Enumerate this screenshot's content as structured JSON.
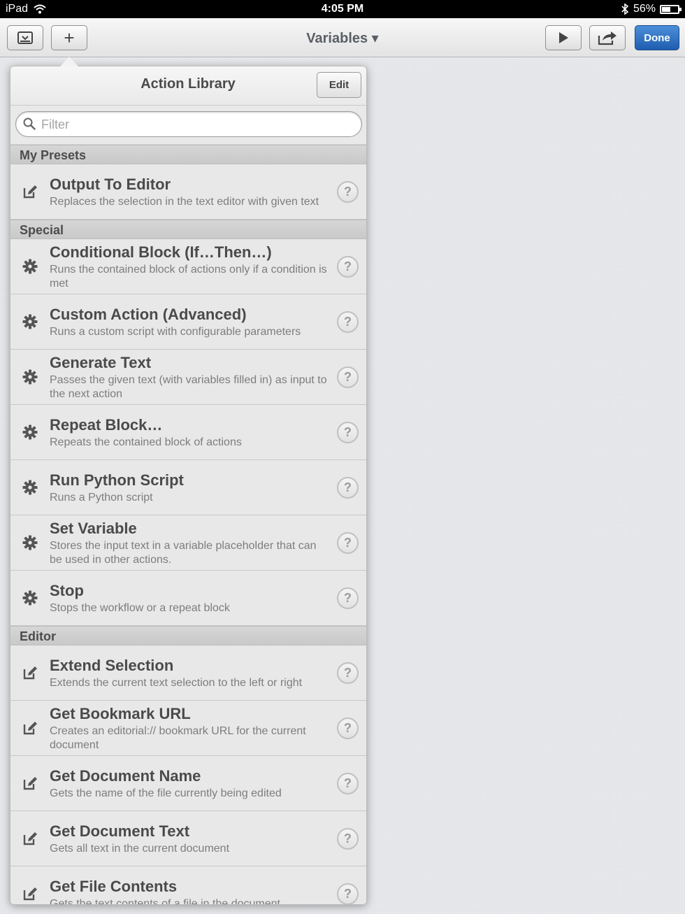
{
  "status_bar": {
    "device": "iPad",
    "time": "4:05 PM",
    "battery": "56%",
    "battery_level": 0.56
  },
  "toolbar": {
    "title": "Variables ▾",
    "done_label": "Done",
    "add_label": "+"
  },
  "popover": {
    "title": "Action Library",
    "edit_label": "Edit",
    "filter_placeholder": "Filter",
    "help_label": "?"
  },
  "sections": [
    {
      "name": "My Presets",
      "items": [
        {
          "title": "Output To Editor",
          "desc": "Replaces the selection in the text editor with given text",
          "icon": "pencil-icon"
        }
      ]
    },
    {
      "name": "Special",
      "items": [
        {
          "title": "Conditional Block (If…Then…)",
          "desc": "Runs the contained block of actions only if a condition is met",
          "icon": "gear-icon"
        },
        {
          "title": "Custom Action (Advanced)",
          "desc": "Runs a custom script with configurable parameters",
          "icon": "gear-icon"
        },
        {
          "title": "Generate Text",
          "desc": "Passes the given text (with variables filled in) as input to the next action",
          "icon": "gear-icon"
        },
        {
          "title": "Repeat Block…",
          "desc": "Repeats the contained block of actions",
          "icon": "gear-icon"
        },
        {
          "title": "Run Python Script",
          "desc": "Runs a Python script",
          "icon": "gear-icon"
        },
        {
          "title": "Set Variable",
          "desc": "Stores the input text in a variable placeholder that can be used in other actions.",
          "icon": "gear-icon"
        },
        {
          "title": "Stop",
          "desc": "Stops the workflow or a repeat block",
          "icon": "gear-icon"
        }
      ]
    },
    {
      "name": "Editor",
      "items": [
        {
          "title": "Extend Selection",
          "desc": "Extends the current text selection to the left or right",
          "icon": "pencil-icon"
        },
        {
          "title": "Get Bookmark URL",
          "desc": "Creates an editorial:// bookmark URL for the current document",
          "icon": "pencil-icon"
        },
        {
          "title": "Get Document Name",
          "desc": "Gets the name of the file currently being edited",
          "icon": "pencil-icon"
        },
        {
          "title": "Get Document Text",
          "desc": "Gets all text in the current document",
          "icon": "pencil-icon"
        },
        {
          "title": "Get File Contents",
          "desc": "Gets the text contents of a file in the document",
          "icon": "pencil-icon"
        }
      ]
    }
  ]
}
